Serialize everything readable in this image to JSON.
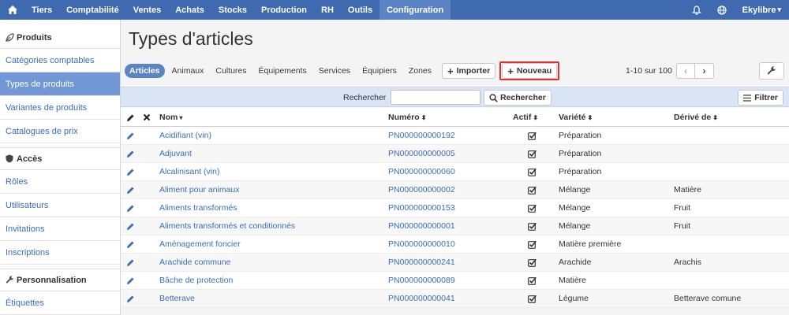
{
  "nav": {
    "home_icon": "home-icon",
    "items": [
      "Tiers",
      "Comptabilité",
      "Ventes",
      "Achats",
      "Stocks",
      "Production",
      "RH",
      "Outils",
      "Configuration"
    ],
    "active": "Configuration",
    "right": {
      "bell_icon": "bell-icon",
      "globe_icon": "globe-icon",
      "user": "Ekylibre",
      "user_caret": "▾"
    }
  },
  "sidebar": {
    "sections": [
      {
        "title": "Produits",
        "icon": "leaf-icon",
        "items": [
          "Catégories comptables",
          "Types de produits",
          "Variantes de produits",
          "Catalogues de prix"
        ]
      },
      {
        "title": "Accès",
        "icon": "shield-icon",
        "items": [
          "Rôles",
          "Utilisateurs",
          "Invitations",
          "Inscriptions"
        ]
      },
      {
        "title": "Personnalisation",
        "icon": "wrench-icon",
        "items": [
          "Étiquettes"
        ]
      }
    ],
    "active_item": "Types de produits"
  },
  "page": {
    "title": "Types d'articles"
  },
  "tabs": [
    "Articles",
    "Animaux",
    "Cultures",
    "Équipements",
    "Services",
    "Équipiers",
    "Zones"
  ],
  "active_tab": "Articles",
  "toolbar": {
    "import_label": "Importer",
    "new_label": "Nouveau",
    "plus": "+"
  },
  "pager": {
    "text": "1-10 sur 100",
    "prev": "‹",
    "next": "›"
  },
  "search": {
    "label": "Rechercher",
    "value": "",
    "button_label": "Rechercher",
    "filter_label": "Filtrer"
  },
  "table": {
    "headers": {
      "nom": "Nom",
      "numero": "Numéro",
      "actif": "Actif",
      "variete": "Variété",
      "derive": "Dérivé de"
    },
    "sort_asc": "▾",
    "sort_both": "⬍",
    "rows": [
      {
        "nom": "Acidifiant (vin)",
        "numero": "PN000000000192",
        "actif": true,
        "variete": "Préparation",
        "derive": ""
      },
      {
        "nom": "Adjuvant",
        "numero": "PN000000000005",
        "actif": true,
        "variete": "Préparation",
        "derive": ""
      },
      {
        "nom": "Alcalinisant (vin)",
        "numero": "PN000000000060",
        "actif": true,
        "variete": "Préparation",
        "derive": ""
      },
      {
        "nom": "Aliment pour animaux",
        "numero": "PN000000000002",
        "actif": true,
        "variete": "Mélange",
        "derive": "Matière"
      },
      {
        "nom": "Aliments transformés",
        "numero": "PN000000000153",
        "actif": true,
        "variete": "Mélange",
        "derive": "Fruit"
      },
      {
        "nom": "Aliments transformés et conditionnés",
        "numero": "PN000000000001",
        "actif": true,
        "variete": "Mélange",
        "derive": "Fruit"
      },
      {
        "nom": "Aménagement foncier",
        "numero": "PN000000000010",
        "actif": true,
        "variete": "Matière première",
        "derive": ""
      },
      {
        "nom": "Arachide commune",
        "numero": "PN000000000241",
        "actif": true,
        "variete": "Arachide",
        "derive": "Arachis"
      },
      {
        "nom": "Bâche de protection",
        "numero": "PN000000000089",
        "actif": true,
        "variete": "Matière",
        "derive": ""
      },
      {
        "nom": "Betterave",
        "numero": "PN000000000041",
        "actif": true,
        "variete": "Légume",
        "derive": "Betterave comune"
      }
    ]
  },
  "colors": {
    "nav_bg": "#3f6ab0",
    "nav_active": "#5b84c7",
    "link": "#3a6db5",
    "sidebar_active": "#7197d4",
    "search_bar": "#d9e4f5",
    "highlight_border": "#e03030"
  }
}
